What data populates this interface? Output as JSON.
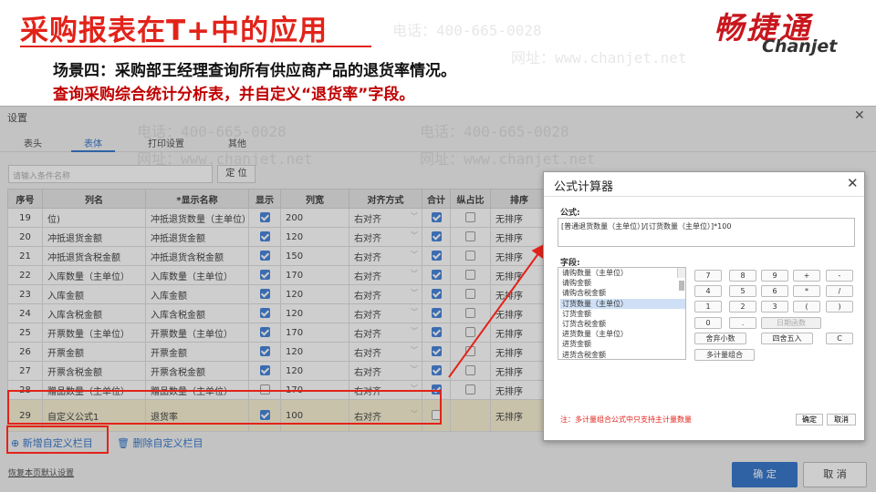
{
  "slide": {
    "title": "采购报表在T+中的应用",
    "logo_cn": "畅捷通",
    "logo_en": "Chanjet",
    "scene": "场景四：采购部王经理查询所有供应商产品的退货率情况。",
    "instruction": "查询采购综合统计分析表，并自定义“退货率”字段。",
    "watermark_phone": "电话：400-665-0028",
    "watermark_site": "网址：www.chanjet.net"
  },
  "settings": {
    "title": "设置",
    "close": "✕",
    "tabs": [
      "表头",
      "表体",
      "打印设置",
      "其他"
    ],
    "active_tab": "表体",
    "search_placeholder": "请输入条件名称",
    "locate_label": "定 位",
    "columns": [
      "序号",
      "列名",
      "*显示名称",
      "显示",
      "列宽",
      "对齐方式",
      "合计",
      "纵占比",
      "排序"
    ],
    "rows": [
      {
        "no": "19",
        "col": "位)",
        "disp": "冲抵退货数量（主单位）",
        "show": true,
        "width": "200",
        "align": "右对齐",
        "sum": true,
        "pct": false,
        "sort": "无排序"
      },
      {
        "no": "20",
        "col": "冲抵退货金额",
        "disp": "冲抵退货金额",
        "show": true,
        "width": "120",
        "align": "右对齐",
        "sum": true,
        "pct": false,
        "sort": "无排序"
      },
      {
        "no": "21",
        "col": "冲抵退货含税金额",
        "disp": "冲抵退货含税金额",
        "show": true,
        "width": "150",
        "align": "右对齐",
        "sum": true,
        "pct": false,
        "sort": "无排序"
      },
      {
        "no": "22",
        "col": "入库数量（主单位）",
        "disp": "入库数量（主单位）",
        "show": true,
        "width": "170",
        "align": "右对齐",
        "sum": true,
        "pct": false,
        "sort": "无排序"
      },
      {
        "no": "23",
        "col": "入库金额",
        "disp": "入库金额",
        "show": true,
        "width": "120",
        "align": "右对齐",
        "sum": true,
        "pct": false,
        "sort": "无排序"
      },
      {
        "no": "24",
        "col": "入库含税金额",
        "disp": "入库含税金额",
        "show": true,
        "width": "120",
        "align": "右对齐",
        "sum": true,
        "pct": false,
        "sort": "无排序"
      },
      {
        "no": "25",
        "col": "开票数量（主单位）",
        "disp": "开票数量（主单位）",
        "show": true,
        "width": "170",
        "align": "右对齐",
        "sum": true,
        "pct": false,
        "sort": "无排序"
      },
      {
        "no": "26",
        "col": "开票金额",
        "disp": "开票金额",
        "show": true,
        "width": "120",
        "align": "右对齐",
        "sum": true,
        "pct": false,
        "sort": "无排序"
      },
      {
        "no": "27",
        "col": "开票含税金额",
        "disp": "开票含税金额",
        "show": true,
        "width": "120",
        "align": "右对齐",
        "sum": true,
        "pct": false,
        "sort": "无排序"
      },
      {
        "no": "28",
        "col": "赠品数量（主单位）",
        "disp": "赠品数量（主单位）",
        "show": false,
        "width": "170",
        "align": "右对齐",
        "sum": true,
        "pct": false,
        "sort": "无排序"
      },
      {
        "no": "29",
        "col": "自定义公式1",
        "disp": "退货率",
        "show": true,
        "width": "100",
        "align": "右对齐",
        "sum": false,
        "pct": null,
        "sort": "无排序",
        "highlight": true
      }
    ],
    "add_column": "新增自定义栏目",
    "delete_column": "删除自定义栏目",
    "restore_default": "恢复本页默认设置",
    "ok": "确 定",
    "cancel": "取 消"
  },
  "formula_dialog": {
    "title": "公式计算器",
    "close": "✕",
    "formula_label": "公式:",
    "formula": "[普通退货数量（主单位）]/[订货数量（主单位）]*100",
    "fields_label": "字段:",
    "fields": [
      "请购数量（主单位）",
      "请购金额",
      "请购含税金额",
      "订货数量（主单位）",
      "订货金额",
      "订货含税金额",
      "进货数量（主单位）",
      "进货金额",
      "进货含税金额"
    ],
    "selected_field": "订货数量（主单位）",
    "keys": [
      "7",
      "8",
      "9",
      "+",
      "-",
      "4",
      "5",
      "6",
      "*",
      "/",
      "1",
      "2",
      "3",
      "(",
      ")",
      "0",
      ".",
      "日期函数",
      "舍弃小数",
      "四舍五入",
      "C",
      "多计量组合"
    ],
    "note": "注：多计量组合公式中只支持主计量数量",
    "ok": "确定",
    "cancel": "取消"
  }
}
